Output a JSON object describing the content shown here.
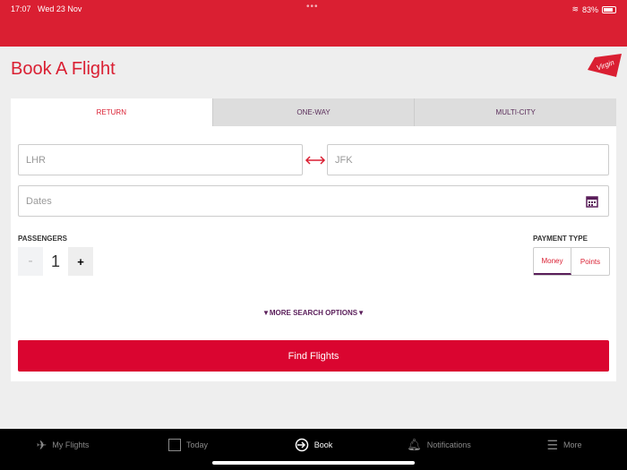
{
  "status": {
    "time": "17:07",
    "date": "Wed 23 Nov",
    "battery": "83%"
  },
  "header": {
    "title": "Book A Flight",
    "logo_text": "Virgin"
  },
  "tabs": [
    {
      "label": "RETURN",
      "active": true
    },
    {
      "label": "ONE-WAY"
    },
    {
      "label": "MULTI-CITY"
    }
  ],
  "form": {
    "from": "LHR",
    "to": "JFK",
    "dates_placeholder": "Dates",
    "passengers_label": "PASSENGERS",
    "passengers_minus": "-",
    "passengers_value": "1",
    "passengers_plus": "+",
    "payment_label": "PAYMENT TYPE",
    "payment_options": [
      "Money",
      "Points"
    ],
    "payment_selected": "Money",
    "more_options": "▼MORE SEARCH OPTIONS▼",
    "find_button": "Find Flights"
  },
  "nav": [
    {
      "label": "My Flights",
      "icon": "plane-icon"
    },
    {
      "label": "Today",
      "icon": "today-icon"
    },
    {
      "label": "Book",
      "icon": "book-icon",
      "active": true
    },
    {
      "label": "Notifications",
      "icon": "bell-icon"
    },
    {
      "label": "More",
      "icon": "menu-icon"
    }
  ]
}
